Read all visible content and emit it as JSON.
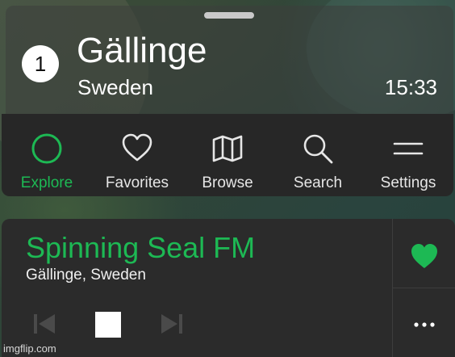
{
  "location": {
    "badge": "1",
    "city": "Gällinge",
    "country": "Sweden",
    "time": "15:33"
  },
  "nav": {
    "items": [
      {
        "label": "Explore",
        "icon": "circle-icon",
        "active": true
      },
      {
        "label": "Favorites",
        "icon": "heart-outline-icon",
        "active": false
      },
      {
        "label": "Browse",
        "icon": "map-icon",
        "active": false
      },
      {
        "label": "Search",
        "icon": "search-icon",
        "active": false
      },
      {
        "label": "Settings",
        "icon": "menu-icon",
        "active": false
      }
    ]
  },
  "player": {
    "station": "Spinning Seal FM",
    "location": "Gällinge, Sweden",
    "favorited": true
  },
  "watermark": "imgflip.com",
  "colors": {
    "accent": "#1db954",
    "panel": "#272727",
    "player_bg": "#2b2b2b"
  }
}
